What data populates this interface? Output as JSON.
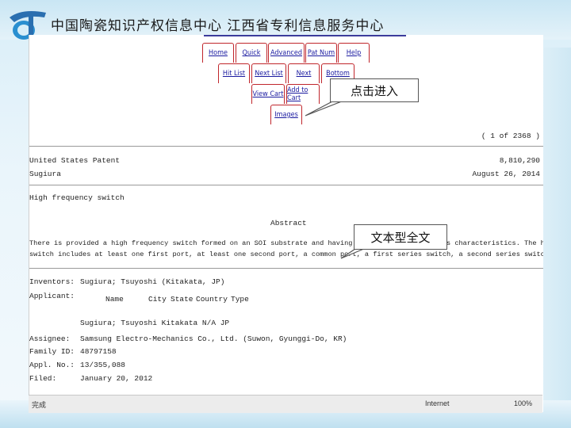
{
  "header": {
    "title": "中国陶瓷知识产权信息中心  江西省专利信息服务中心"
  },
  "nav": {
    "home": "Home",
    "quick": "Quick",
    "advanced": "Advanced",
    "pat_num": "Pat Num",
    "help": "Help",
    "hit_list": "Hit List",
    "next_list": "Next List",
    "next": "Next",
    "bottom": "Bottom",
    "view_cart": "View Cart",
    "add_to_cart": "Add to Cart",
    "images": "Images"
  },
  "callouts": {
    "click_enter": "点击进入",
    "full_text": "文本型全文"
  },
  "patent": {
    "hit_count": "( 1 of 2368 )",
    "patent_type": "United States Patent",
    "patent_number": "8,810,290",
    "inventor_short": "Sugiura",
    "date": "August 26, 2014",
    "title": "High frequency switch",
    "abstract_heading": "Abstract",
    "abstract_line1": "There is provided a high frequency switch formed on an SOI substrate and having improved insertion loss characteristics. The high frequency",
    "abstract_line2": "switch includes at least one first port, at least one second port, a common port, a first series switch, a second series switch.",
    "inventors_label": "Inventors:",
    "inventors_value": "Sugiura; Tsuyoshi (Kitakata, JP)",
    "applicant_label": "Applicant:",
    "applicant_cols": [
      "Name",
      "City",
      "State",
      "Country",
      "Type"
    ],
    "applicant_value": "Sugiura; Tsuyoshi  Kitakata  N/A  JP",
    "assignee_label": "Assignee:",
    "assignee_value": "Samsung Electro-Mechanics Co., Ltd. (Suwon, Gyunggi-Do, KR)",
    "family_label": "Family ID:",
    "family_value": "48797158",
    "appl_label": "Appl. No.:",
    "appl_value": "13/355,088",
    "filed_label": "Filed:",
    "filed_value": "January 20, 2012"
  },
  "status_bar": {
    "left": "完成",
    "middle": "Internet",
    "zoom": "100%"
  }
}
